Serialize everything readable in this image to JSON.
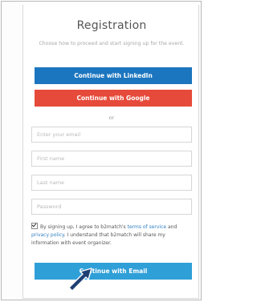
{
  "form": {
    "title": "Registration",
    "subtitle": "Choose how to proceed and start signing up for the event.",
    "linkedin_button": "Continue with LinkedIn",
    "google_button": "Continue with Google",
    "divider": "or",
    "email_placeholder": "Enter your email",
    "first_name_placeholder": "First name",
    "last_name_placeholder": "Last name",
    "password_placeholder": "Password",
    "consent": {
      "checked": true,
      "text_1": "By signing up, I agree to b2match's ",
      "terms_link": "terms of service",
      "text_2": " and ",
      "privacy_link": "privacy policy",
      "text_3": ". I understand that b2match will share my information with event organizer."
    },
    "email_button": "Continue with Email"
  },
  "colors": {
    "linkedin": "#1c76bf",
    "google": "#e64a3a",
    "email": "#2f9fd8",
    "link": "#2f7fc2"
  },
  "icons": {
    "cursor": "mouse-pointer-arrow-icon"
  }
}
